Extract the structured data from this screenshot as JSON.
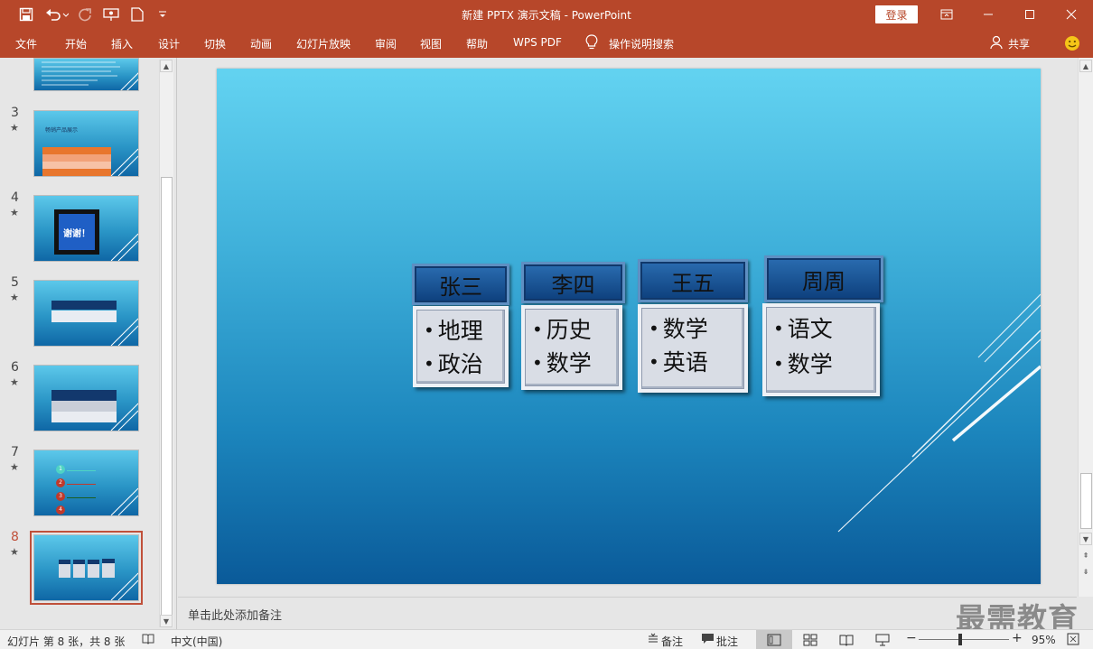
{
  "window": {
    "title": "新建 PPTX 演示文稿  -  PowerPoint",
    "login": "登录"
  },
  "ribbon": {
    "tabs": [
      "文件",
      "开始",
      "插入",
      "设计",
      "切换",
      "动画",
      "幻灯片放映",
      "审阅",
      "视图",
      "帮助",
      "WPS PDF"
    ],
    "tell_me": "操作说明搜索",
    "share": "共享"
  },
  "thumbnails": [
    {
      "number": "3",
      "star": "★",
      "text": "畅销产品展示"
    },
    {
      "number": "4",
      "star": "★",
      "text": "谢谢！"
    },
    {
      "number": "5",
      "star": "★"
    },
    {
      "number": "6",
      "star": "★"
    },
    {
      "number": "7",
      "star": "★",
      "steps": [
        "1",
        "2",
        "3",
        "4"
      ]
    },
    {
      "number": "8",
      "star": "★",
      "selected": true
    }
  ],
  "slide": {
    "cards": [
      {
        "title": "张三",
        "items": [
          "地理",
          "政治"
        ]
      },
      {
        "title": "李四",
        "items": [
          "历史",
          "数学"
        ]
      },
      {
        "title": "王五",
        "items": [
          "数学",
          "英语"
        ]
      },
      {
        "title": "周周",
        "items": [
          "语文",
          "数学"
        ]
      }
    ]
  },
  "notes": {
    "placeholder": "单击此处添加备注"
  },
  "watermark": "最需教育",
  "status": {
    "slide_info": "幻灯片 第 8 张，共 8 张",
    "language": "中文(中国)",
    "notes_btn": "备注",
    "comments_btn": "批注",
    "zoom": "95%"
  },
  "colors": {
    "accent": "#b7472a"
  }
}
